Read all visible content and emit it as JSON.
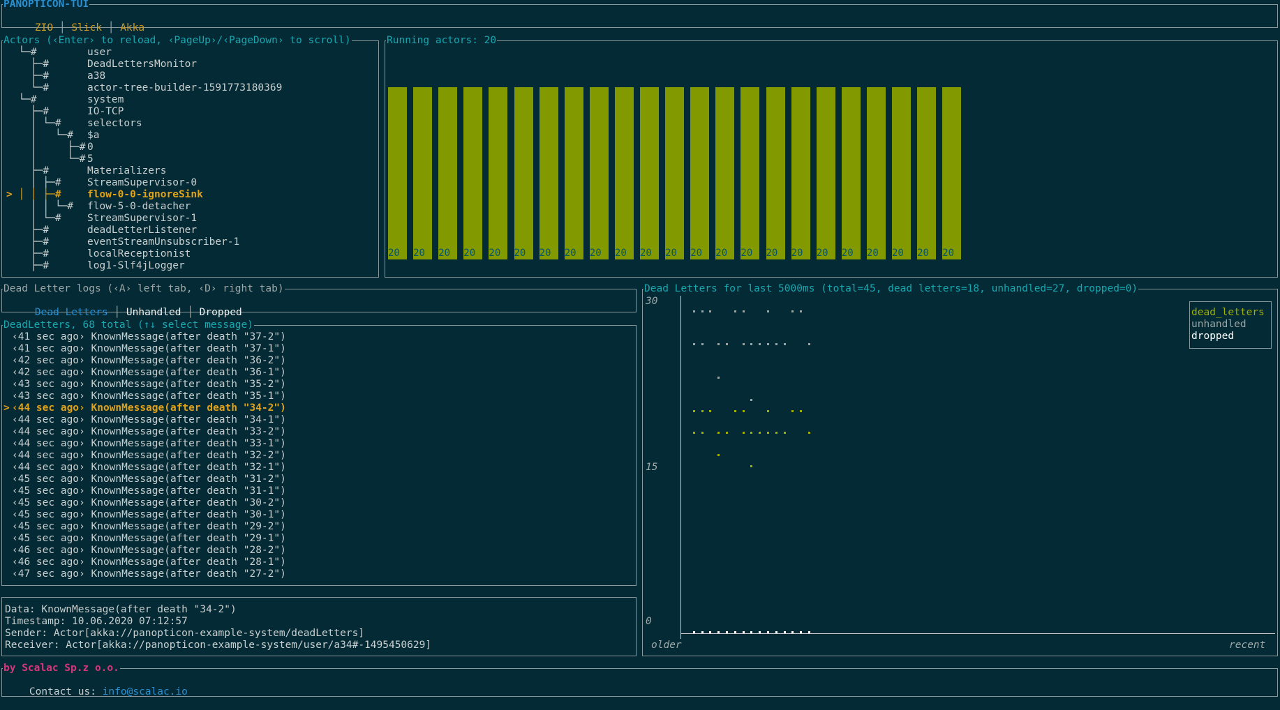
{
  "app": {
    "title": "PANOPTICON-TUI",
    "tabs": [
      "ZIO",
      "Slick",
      "Akka"
    ]
  },
  "actors": {
    "title": "Actors (‹Enter› to reload, ‹PageUp›/‹PageDown› to scroll)",
    "tree": [
      {
        "prefix": "  └─#",
        "label": "user"
      },
      {
        "prefix": "    ├─#",
        "label": "DeadLettersMonitor"
      },
      {
        "prefix": "    ├─#",
        "label": "a38"
      },
      {
        "prefix": "    └─#",
        "label": "actor-tree-builder-1591773180369"
      },
      {
        "prefix": "  └─#",
        "label": "system"
      },
      {
        "prefix": "    ├─#",
        "label": "IO-TCP"
      },
      {
        "prefix": "    │ └─#",
        "label": "selectors"
      },
      {
        "prefix": "    │   └─#",
        "label": "$a"
      },
      {
        "prefix": "    │     ├─#",
        "label": "0"
      },
      {
        "prefix": "    │     └─#",
        "label": "5"
      },
      {
        "prefix": "    ├─#",
        "label": "Materializers"
      },
      {
        "prefix": "    │ ├─#",
        "label": "StreamSupervisor-0"
      },
      {
        "prefix": "> │ │ ├─#",
        "label": "flow-0-0-ignoreSink",
        "selected": true
      },
      {
        "prefix": "    │ │ └─#",
        "label": "flow-5-0-detacher"
      },
      {
        "prefix": "    │ └─#",
        "label": "StreamSupervisor-1"
      },
      {
        "prefix": "    ├─#",
        "label": "deadLetterListener"
      },
      {
        "prefix": "    ├─#",
        "label": "eventStreamUnsubscriber-1"
      },
      {
        "prefix": "    ├─#",
        "label": "localReceptionist"
      },
      {
        "prefix": "    ├─#",
        "label": "log1-Slf4jLogger"
      }
    ]
  },
  "running": {
    "title": "Running actors: 20",
    "chart_data": {
      "type": "bar",
      "values": [
        20,
        20,
        20,
        20,
        20,
        20,
        20,
        20,
        20,
        20,
        20,
        20,
        20,
        20,
        20,
        20,
        20,
        20,
        20,
        20,
        20,
        20,
        20
      ],
      "data_labels": [
        "20",
        "20",
        "20",
        "20",
        "20",
        "20",
        "20",
        "20",
        "20",
        "20",
        "20",
        "20",
        "20",
        "20",
        "20",
        "20",
        "20",
        "20",
        "20",
        "20",
        "20",
        "20",
        "20"
      ],
      "color": "#829a00"
    }
  },
  "logs": {
    "title": "Dead Letter logs (‹A› left tab, ‹D› right tab)",
    "tabs": [
      "Dead Letters",
      "Unhandled",
      "Dropped"
    ],
    "active_tab": "Dead Letters"
  },
  "messages": {
    "title": "DeadLetters, 68 total (↑↓ select message)",
    "items": [
      "‹41 sec ago› KnownMessage(after death \"37-2\")",
      "‹41 sec ago› KnownMessage(after death \"37-1\")",
      "‹42 sec ago› KnownMessage(after death \"36-2\")",
      "‹42 sec ago› KnownMessage(after death \"36-1\")",
      "‹43 sec ago› KnownMessage(after death \"35-2\")",
      "‹43 sec ago› KnownMessage(after death \"35-1\")",
      "‹44 sec ago› KnownMessage(after death \"34-2\")",
      "‹44 sec ago› KnownMessage(after death \"34-1\")",
      "‹44 sec ago› KnownMessage(after death \"33-2\")",
      "‹44 sec ago› KnownMessage(after death \"33-1\")",
      "‹44 sec ago› KnownMessage(after death \"32-2\")",
      "‹44 sec ago› KnownMessage(after death \"32-1\")",
      "‹45 sec ago› KnownMessage(after death \"31-2\")",
      "‹45 sec ago› KnownMessage(after death \"31-1\")",
      "‹45 sec ago› KnownMessage(after death \"30-2\")",
      "‹45 sec ago› KnownMessage(after death \"30-1\")",
      "‹45 sec ago› KnownMessage(after death \"29-2\")",
      "‹45 sec ago› KnownMessage(after death \"29-1\")",
      "‹46 sec ago› KnownMessage(after death \"28-2\")",
      "‹46 sec ago› KnownMessage(after death \"28-1\")",
      "‹47 sec ago› KnownMessage(after death \"27-2\")"
    ],
    "selected_index": 6,
    "selected_marker": ">"
  },
  "details": {
    "data": "Data: KnownMessage(after death \"34-2\")",
    "timestamp": "Timestamp: 10.06.2020 07:12:57",
    "sender": "Sender: Actor[akka://panopticon-example-system/deadLetters]",
    "receiver": "Receiver: Actor[akka://panopticon-example-system/user/a34#-1495450629]"
  },
  "deadchart": {
    "title": "Dead Letters for last 5000ms (total=45, dead letters=18, unhandled=27, dropped=0)",
    "y_ticks": [
      "30",
      "15",
      "0"
    ],
    "x_left": "older",
    "x_right": "recent",
    "legend": [
      "dead_letters",
      "unhandled",
      "dropped"
    ],
    "colors": {
      "dead_letters": "#a0b000",
      "unhandled": "#9ba5a5",
      "dropped": "#ffffff"
    },
    "chart_data": {
      "type": "scatter",
      "ylim": [
        0,
        30
      ],
      "legend_position": "top-right",
      "series": [
        {
          "name": "unhandled",
          "points": [
            [
              1,
              29
            ],
            [
              2,
              29
            ],
            [
              3,
              29
            ],
            [
              6,
              29
            ],
            [
              7,
              29
            ],
            [
              10,
              29
            ],
            [
              13,
              29
            ],
            [
              14,
              29
            ],
            [
              1,
              26
            ],
            [
              2,
              26
            ],
            [
              4,
              26
            ],
            [
              5,
              26
            ],
            [
              7,
              26
            ],
            [
              8,
              26
            ],
            [
              9,
              26
            ],
            [
              10,
              26
            ],
            [
              11,
              26
            ],
            [
              12,
              26
            ],
            [
              15,
              26
            ],
            [
              4,
              23
            ],
            [
              8,
              21
            ]
          ]
        },
        {
          "name": "dead_letters",
          "points": [
            [
              1,
              20
            ],
            [
              2,
              20
            ],
            [
              3,
              20
            ],
            [
              6,
              20
            ],
            [
              7,
              20
            ],
            [
              10,
              20
            ],
            [
              13,
              20
            ],
            [
              14,
              20
            ],
            [
              1,
              18
            ],
            [
              2,
              18
            ],
            [
              4,
              18
            ],
            [
              5,
              18
            ],
            [
              7,
              18
            ],
            [
              8,
              18
            ],
            [
              9,
              18
            ],
            [
              10,
              18
            ],
            [
              11,
              18
            ],
            [
              12,
              18
            ],
            [
              15,
              18
            ],
            [
              4,
              16
            ],
            [
              8,
              15
            ]
          ]
        },
        {
          "name": "dropped",
          "points": [
            [
              1,
              0
            ],
            [
              2,
              0
            ],
            [
              3,
              0
            ],
            [
              4,
              0
            ],
            [
              5,
              0
            ],
            [
              6,
              0
            ],
            [
              7,
              0
            ],
            [
              8,
              0
            ],
            [
              9,
              0
            ],
            [
              10,
              0
            ],
            [
              11,
              0
            ],
            [
              12,
              0
            ],
            [
              13,
              0
            ],
            [
              14,
              0
            ],
            [
              15,
              0
            ]
          ]
        }
      ]
    }
  },
  "footer": {
    "title": "by Scalac Sp.z o.o.",
    "contact_label": "Contact us: ",
    "contact_email": "info@scalac.io"
  }
}
